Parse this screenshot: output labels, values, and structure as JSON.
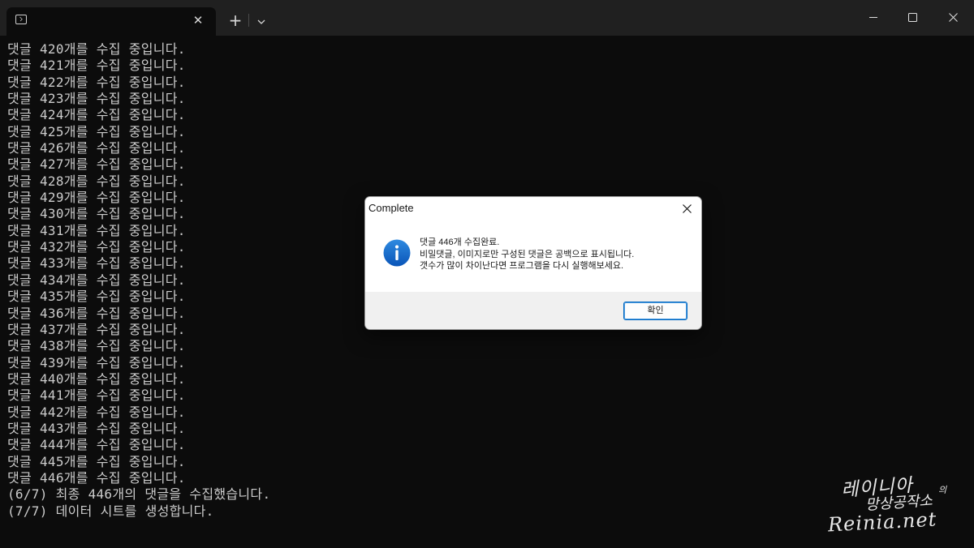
{
  "titlebar": {
    "tab": {
      "icon": "console-icon",
      "close_icon": "close-icon"
    },
    "new_tab_icon": "plus-icon",
    "dropdown_icon": "chevron-down-icon",
    "window_controls": [
      "minimize-icon",
      "maximize-icon",
      "close-icon"
    ]
  },
  "console": {
    "lines": [
      "댓글 420개를 수집 중입니다.",
      "댓글 421개를 수집 중입니다.",
      "댓글 422개를 수집 중입니다.",
      "댓글 423개를 수집 중입니다.",
      "댓글 424개를 수집 중입니다.",
      "댓글 425개를 수집 중입니다.",
      "댓글 426개를 수집 중입니다.",
      "댓글 427개를 수집 중입니다.",
      "댓글 428개를 수집 중입니다.",
      "댓글 429개를 수집 중입니다.",
      "댓글 430개를 수집 중입니다.",
      "댓글 431개를 수집 중입니다.",
      "댓글 432개를 수집 중입니다.",
      "댓글 433개를 수집 중입니다.",
      "댓글 434개를 수집 중입니다.",
      "댓글 435개를 수집 중입니다.",
      "댓글 436개를 수집 중입니다.",
      "댓글 437개를 수집 중입니다.",
      "댓글 438개를 수집 중입니다.",
      "댓글 439개를 수집 중입니다.",
      "댓글 440개를 수집 중입니다.",
      "댓글 441개를 수집 중입니다.",
      "댓글 442개를 수집 중입니다.",
      "댓글 443개를 수집 중입니다.",
      "댓글 444개를 수집 중입니다.",
      "댓글 445개를 수집 중입니다.",
      "댓글 446개를 수집 중입니다.",
      "(6/7) 최종 446개의 댓글을 수집했습니다.",
      "(7/7) 데이터 시트를 생성합니다."
    ]
  },
  "dialog": {
    "title": "Complete",
    "icon": "info-icon",
    "message_lines": [
      "댓글 446개 수집완료.",
      "비밀댓글, 이미지로만 구성된 댓글은 공백으로 표시됩니다.",
      "갯수가 많이 차이난다면 프로그램을 다시 실행해보세요."
    ],
    "ok_label": "확인",
    "accent_color": "#0067c0",
    "icon_color": "#0a64c8"
  },
  "watermark": {
    "line1": "레이니아",
    "small": "의",
    "line2": "망상공작소",
    "line3": "Reinia.net"
  }
}
